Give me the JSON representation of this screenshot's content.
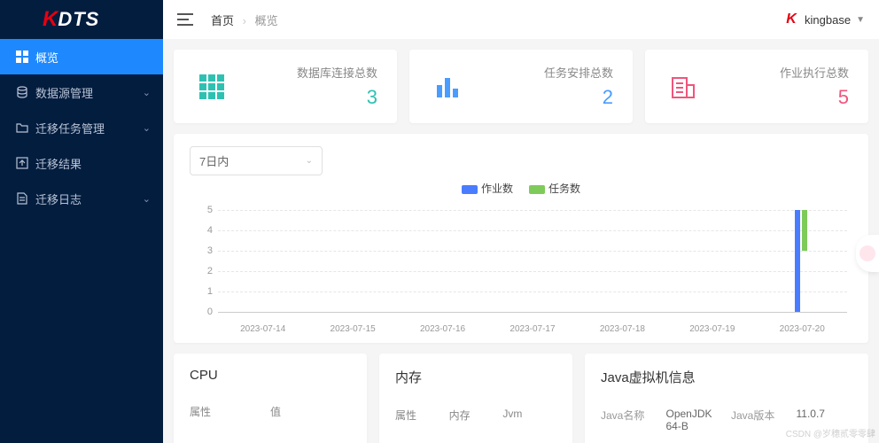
{
  "brand": {
    "k": "K",
    "name": "DTS"
  },
  "sidebar": {
    "items": [
      {
        "label": "概览"
      },
      {
        "label": "数据源管理"
      },
      {
        "label": "迁移任务管理"
      },
      {
        "label": "迁移结果"
      },
      {
        "label": "迁移日志"
      }
    ]
  },
  "topbar": {
    "home": "首页",
    "current": "概览",
    "username": "kingbase"
  },
  "stats": [
    {
      "label": "数据库连接总数",
      "value": "3",
      "color": "#2ec1b2"
    },
    {
      "label": "任务安排总数",
      "value": "2",
      "color": "#4a9cff"
    },
    {
      "label": "作业执行总数",
      "value": "5",
      "color": "#f0557d"
    }
  ],
  "chart_select": "7日内",
  "chart_data": {
    "type": "bar",
    "categories": [
      "2023-07-14",
      "2023-07-15",
      "2023-07-16",
      "2023-07-17",
      "2023-07-18",
      "2023-07-19",
      "2023-07-20"
    ],
    "series": [
      {
        "name": "作业数",
        "color": "#4a7cff",
        "values": [
          0,
          0,
          0,
          0,
          0,
          0,
          5
        ]
      },
      {
        "name": "任务数",
        "color": "#7ecb5a",
        "values": [
          0,
          0,
          0,
          0,
          0,
          0,
          2
        ]
      }
    ],
    "ylim": [
      0,
      5
    ],
    "yticks": [
      0,
      1,
      2,
      3,
      4,
      5
    ]
  },
  "info_cards": {
    "cpu": {
      "title": "CPU",
      "cols": [
        "属性",
        "值"
      ]
    },
    "mem": {
      "title": "内存",
      "cols": [
        "属性",
        "内存",
        "Jvm"
      ]
    },
    "jvm": {
      "title": "Java虚拟机信息",
      "rows": [
        {
          "k": "Java名称",
          "v": "OpenJDK 64-B"
        },
        {
          "k": "Java版本",
          "v": "11.0.7"
        }
      ]
    }
  },
  "watermark": "CSDN @岁穗贰零零肆"
}
